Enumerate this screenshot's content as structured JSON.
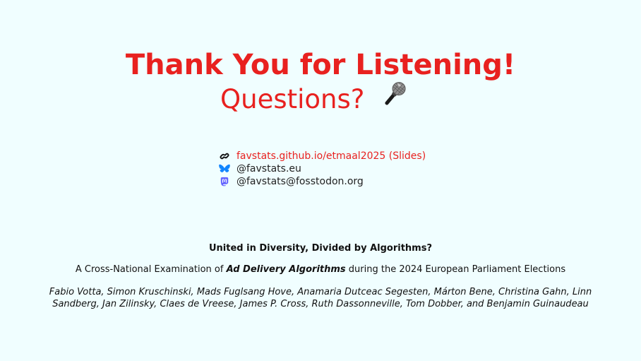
{
  "slide": {
    "title": "Thank You for Listening!",
    "subtitle": "Questions?",
    "mic_icon": "microphone-icon"
  },
  "links": [
    {
      "icon": "link-icon",
      "text": "favstats.github.io/etmaal2025 (Slides)",
      "color": "#e8211f"
    },
    {
      "icon": "bluesky-butterfly-icon",
      "text": "@favstats.eu",
      "color": "#1185fe"
    },
    {
      "icon": "mastodon-icon",
      "text": "@favstats@fosstodon.org",
      "color": "#6364ff"
    }
  ],
  "paper": {
    "title": "United in Diversity, Divided by Algorithms?",
    "subtitle_prefix": "A Cross-National Examination of ",
    "subtitle_emph": "Ad Delivery Algorithms",
    "subtitle_suffix": " during the 2024 European Parliament Elections",
    "authors": "Fabio Votta, Simon Kruschinski, Mads Fuglsang Hove, Anamaria Dutceac Segesten, Márton Bene, Christina Gahn, Linn Sandberg, Jan Zilinsky, Claes de Vreese, James P. Cross, Ruth Dassonneville, Tom Dobber, and Benjamin Guinaudeau"
  },
  "colors": {
    "accent": "#e8211f",
    "background": "#f0feff"
  }
}
